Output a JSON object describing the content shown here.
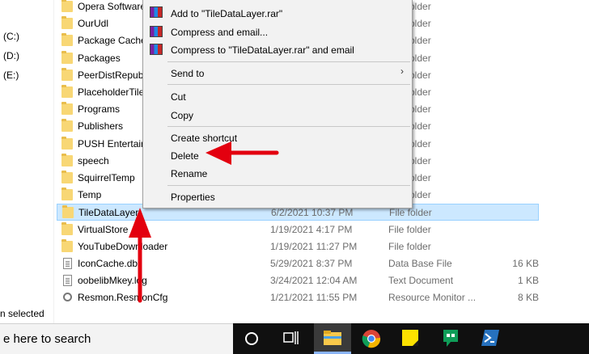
{
  "nav": {
    "drives": [
      "(C:)",
      "(D:)",
      "(E:)"
    ],
    "status": "n selected"
  },
  "files": [
    {
      "name": "Opera Software",
      "date": "",
      "type": "File folder",
      "size": "",
      "kind": "folder"
    },
    {
      "name": "OurUdl",
      "date": "",
      "type": "File folder",
      "size": "",
      "kind": "folder"
    },
    {
      "name": "Package Cache",
      "date": "",
      "type": "File folder",
      "size": "",
      "kind": "folder"
    },
    {
      "name": "Packages",
      "date": "",
      "type": "File folder",
      "size": "",
      "kind": "folder"
    },
    {
      "name": "PeerDistRepub",
      "date": "",
      "type": "File folder",
      "size": "",
      "kind": "folder"
    },
    {
      "name": "PlaceholderTileL",
      "date": "",
      "type": "File folder",
      "size": "",
      "kind": "folder"
    },
    {
      "name": "Programs",
      "date": "",
      "type": "File folder",
      "size": "",
      "kind": "folder"
    },
    {
      "name": "Publishers",
      "date": "",
      "type": "File folder",
      "size": "",
      "kind": "folder"
    },
    {
      "name": "PUSH Entertainn",
      "date": "",
      "type": "File folder",
      "size": "",
      "kind": "folder"
    },
    {
      "name": "speech",
      "date": "",
      "type": "File folder",
      "size": "",
      "kind": "folder"
    },
    {
      "name": "SquirrelTemp",
      "date": "",
      "type": "File folder",
      "size": "",
      "kind": "folder"
    },
    {
      "name": "Temp",
      "date": "",
      "type": "File folder",
      "size": "",
      "kind": "folder"
    },
    {
      "name": "TileDataLayer",
      "date": "6/2/2021 10:37 PM",
      "type": "File folder",
      "size": "",
      "kind": "folder",
      "selected": true
    },
    {
      "name": "VirtualStore",
      "date": "1/19/2021 4:17 PM",
      "type": "File folder",
      "size": "",
      "kind": "folder"
    },
    {
      "name": "YouTubeDownloader",
      "date": "1/19/2021 11:27 PM",
      "type": "File folder",
      "size": "",
      "kind": "folder"
    },
    {
      "name": "IconCache.db",
      "date": "5/29/2021 8:37 PM",
      "type": "Data Base File",
      "size": "16 KB",
      "kind": "file"
    },
    {
      "name": "oobelibMkey.log",
      "date": "3/24/2021 12:04 AM",
      "type": "Text Document",
      "size": "1 KB",
      "kind": "file"
    },
    {
      "name": "Resmon.ResmonCfg",
      "date": "1/21/2021 11:55 PM",
      "type": "Resource Monitor ...",
      "size": "8 KB",
      "kind": "gear"
    }
  ],
  "context_menu": {
    "add_to_rar": "Add to \"TileDataLayer.rar\"",
    "compress_email": "Compress and email...",
    "compress_rar_email": "Compress to \"TileDataLayer.rar\" and email",
    "send_to": "Send to",
    "cut": "Cut",
    "copy": "Copy",
    "create_shortcut": "Create shortcut",
    "delete": "Delete",
    "rename": "Rename",
    "properties": "Properties"
  },
  "taskbar": {
    "search_placeholder": "e here to search"
  },
  "colors": {
    "annotation_arrow": "#e3000f",
    "selection": "#cce8ff",
    "taskbar": "#101010"
  },
  "icons": [
    "folder-icon",
    "file-icon",
    "gear-icon",
    "rar-icon",
    "chevron-right-icon",
    "cortana-icon",
    "task-view-icon",
    "file-explorer-icon",
    "chrome-icon",
    "sticky-notes-icon",
    "hangouts-icon",
    "powershell-icon"
  ]
}
